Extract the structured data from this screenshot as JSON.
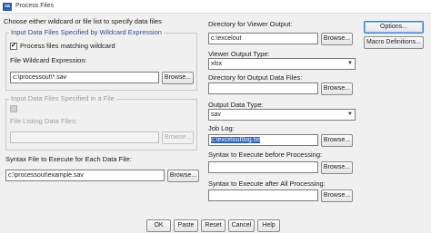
{
  "window": {
    "title": "Process Files",
    "icon": "spss-app-icon"
  },
  "left": {
    "instruction": "Choose either wildcard or file list to specify data files",
    "wildcard_group": {
      "legend": "Input Data Files Specified by Wildcard Expression",
      "checkbox_label": "Process files matching wildcard",
      "checked": true,
      "expression_label": "File Wildcard Expression:",
      "expression_value": "c:\\processout\\*.sav",
      "browse_label": "Browse..."
    },
    "filelist_group": {
      "legend": "Input Data Files Specified in a File",
      "checkbox_label": "",
      "listing_label": "File Listing Data Files:",
      "listing_value": "",
      "browse_label": "Browse..."
    },
    "syntax_label": "Syntax File to Execute for Each Data File:",
    "syntax_value": "c:\\processout\\example.sav",
    "syntax_browse": "Browse..."
  },
  "middle": {
    "viewer_dir_label": "Directory for Viewer Output:",
    "viewer_dir_value": "c:\\excelout",
    "viewer_dir_browse": "Browse...",
    "viewer_type_label": "Viewer Output Type:",
    "viewer_type_value": "xlsx",
    "output_dir_label": "Directory for Output Data Files:",
    "output_dir_value": "",
    "output_dir_browse": "Browse...",
    "output_type_label": "Output Data Type:",
    "output_type_value": "sav",
    "job_log_label": "Job Log:",
    "job_log_value": "c:\\excelout\\log.txt",
    "job_log_browse": "Browse...",
    "before_label": "Syntax to Execute before Processing:",
    "before_value": "",
    "before_browse": "Browse...",
    "after_label": "Syntax to Execute after All Processing:",
    "after_value": "",
    "after_browse": "Browse..."
  },
  "right": {
    "options_label": "Options...",
    "macro_label": "Macro Definitions..."
  },
  "footer": {
    "ok": "OK",
    "paste": "Paste",
    "reset": "Reset",
    "cancel": "Cancel",
    "help": "Help"
  },
  "colors": {
    "accent": "#2a4f8c",
    "selection": "#2b62c8"
  }
}
